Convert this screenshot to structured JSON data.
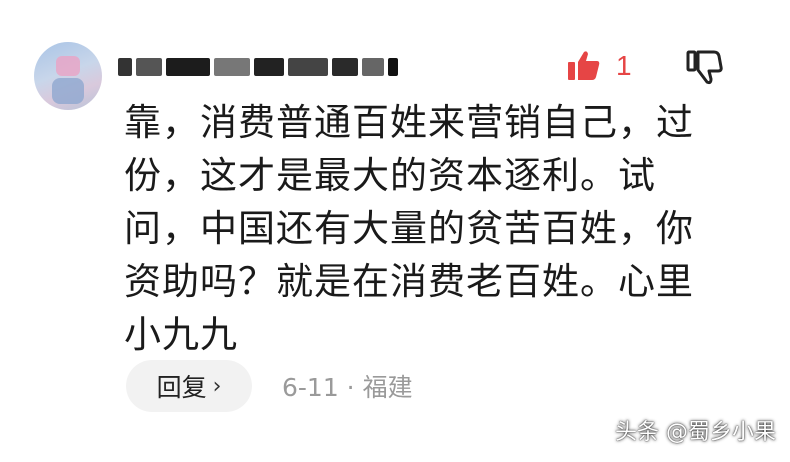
{
  "comment": {
    "like_count": "1",
    "lines": [
      "靠，消费普通百姓来营销自己，过",
      "份，这才是最大的资本逐利。试",
      "问，中国还有大量的贫苦百姓，你",
      "资助吗？就是在消费老百姓。心里",
      "小九九"
    ],
    "reply_label": "回复",
    "reply_chevron": "›",
    "meta": "6-11 · 福建"
  },
  "icons": {
    "like": "thumbs-up-filled-icon",
    "dislike": "thumbs-down-outline-icon",
    "reply_chevron": "chevron-right-icon"
  },
  "colors": {
    "like_accent": "#e64545",
    "text": "#1a1a1a",
    "meta": "#9a9a9a",
    "reply_bg": "#f2f2f2"
  },
  "watermark": "头条 @蜀乡小果"
}
